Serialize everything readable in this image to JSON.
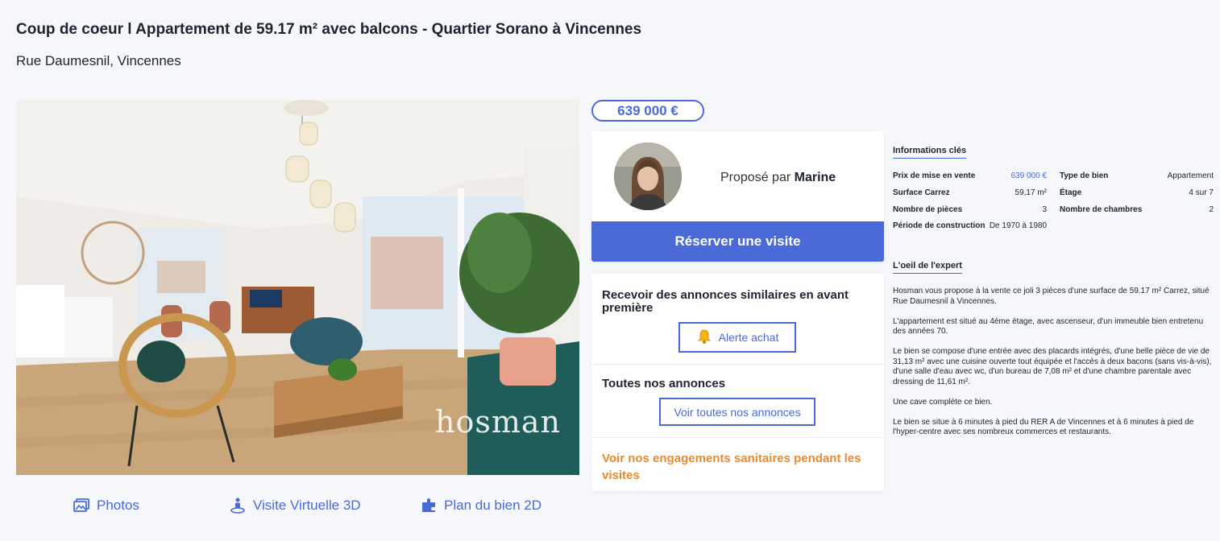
{
  "listing": {
    "title": "Coup de coeur l Appartement de 59.17 m² avec balcons - Quartier Sorano à Vincennes",
    "address": "Rue Daumesnil, Vincennes",
    "watermark": "hosman",
    "price": "639 000 €"
  },
  "media_tabs": [
    {
      "label": "Photos",
      "icon": "photos-icon"
    },
    {
      "label": "Visite Virtuelle 3D",
      "icon": "virtual-visit-icon"
    },
    {
      "label": "Plan du bien 2D",
      "icon": "floor-plan-icon"
    }
  ],
  "agent": {
    "prefix": "Proposé par",
    "name": "Marine",
    "book_label": "Réserver une visite"
  },
  "alerts": {
    "similar_title": "Recevoir des annonces similaires en avant première",
    "alert_button": "Alerte achat",
    "all_title": "Toutes nos annonces",
    "all_button": "Voir toutes nos annonces",
    "sanitary_link": "Voir nos engagements sanitaires pendant les visites"
  },
  "key_info": {
    "heading": "Informations clés",
    "items": [
      {
        "label": "Prix de mise en vente",
        "value": "639 000 €"
      },
      {
        "label": "Type de bien",
        "value": "Appartement"
      },
      {
        "label": "Surface Carrez",
        "value": "59,17 m²"
      },
      {
        "label": "Étage",
        "value": "4 sur 7"
      },
      {
        "label": "Nombre de pièces",
        "value": "3"
      },
      {
        "label": "Nombre de chambres",
        "value": "2"
      },
      {
        "label": "Période de construction",
        "value": "De 1970 à 1980"
      }
    ]
  },
  "expert": {
    "heading": "L'oeil de l'expert",
    "paragraphs": [
      "Hosman vous propose à la vente ce joli 3 pièces d'une surface de 59.17 m² Carrez, situé Rue Daumesnil à Vincennes.",
      "L'appartement est situé au 4ème étage, avec ascenseur, d'un immeuble bien entretenu des années 70.",
      "Le bien se compose d'une entrée avec des placards intégrés, d'une belle pièce de vie de 31,13 m² avec une cuisine ouverte tout équipée et l'accès à deux bacons (sans vis-à-vis), d'une salle d'eau avec wc, d'un bureau de 7,08 m² et d'une chambre parentale avec dressing de 11,61 m².",
      "Une cave complète ce bien.",
      "Le bien se situe à 6 minutes à pied du RER A de Vincennes et à 6 minutes à pied de l'hyper-centre avec ses nombreux commerces et restaurants."
    ]
  },
  "colors": {
    "accent": "#4a6ad8",
    "orange": "#ea8a2f",
    "text": "#1e2330",
    "background": "#f6f7fa"
  }
}
